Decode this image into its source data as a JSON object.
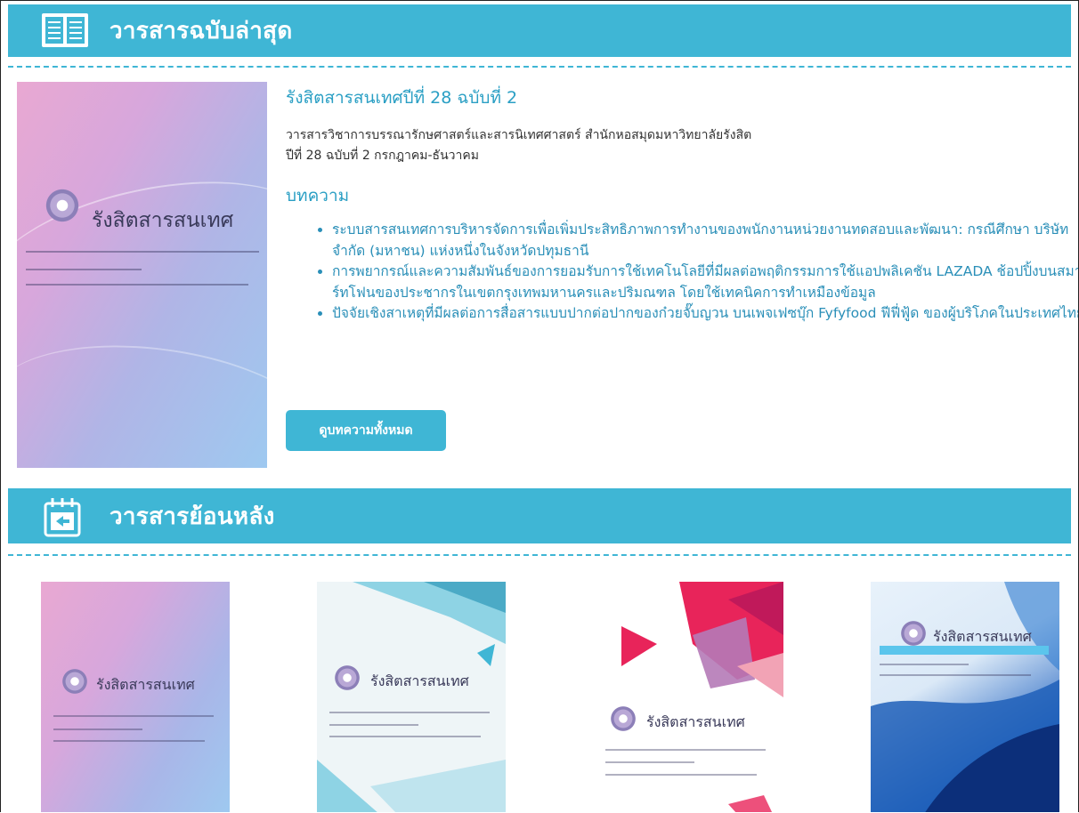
{
  "latest": {
    "section_title": "วารสารฉบับล่าสุด",
    "cover_title": "รังสิตสารสนเทศ",
    "issue_title": "รังสิตสารสนเทศปีที่ 28 ฉบับที่ 2",
    "desc_line1": "วารสารวิชาการบรรณารักษศาสตร์และสารนิเทศศาสตร์ สำนักหอสมุดมหาวิทยาลัยรังสิต",
    "desc_line2": "ปีที่ 28 ฉบับที่ 2 กรกฎาคม-ธันวาคม",
    "articles_heading": "บทความ",
    "articles": [
      "ระบบสารสนเทศการบริหารจัดการเพื่อเพิ่มประสิทธิภาพการทำงานของพนักงานหน่วยงานทดสอบและพัฒนา: กรณีศึกษา บริษัทจำกัด (มหาชน) แห่งหนึ่งในจังหวัดปทุมธานี",
      "การพยากรณ์และความสัมพันธ์ของการยอมรับการใช้เทคโนโลยีที่มีผลต่อพฤติกรรมการใช้แอปพลิเคชัน LAZADA ช้อปปิ้งบนสมาร์ทโฟนของประชากรในเขตกรุงเทพมหานครและปริมณฑล โดยใช้เทคนิคการทำเหมืองข้อมูล",
      "ปัจจัยเชิงสาเหตุที่มีผลต่อการสื่อสารแบบปากต่อปากของก๋วยจั๊บญวน บนเพจเฟซบุ๊ก Fyfyfood ฟีฟี่ฟู้ด ของผู้บริโภคในประเทศไทย"
    ],
    "all_button": "ดูบทความทั้งหมด"
  },
  "archive": {
    "section_title": "วารสารย้อนหลัง",
    "cover_title": "รังสิตสารสนเทศ"
  },
  "colors": {
    "accent": "#3fb6d5",
    "link": "#2a8fb8"
  },
  "icons": {
    "latest": "open-book-icon",
    "archive": "calendar-back-icon"
  }
}
